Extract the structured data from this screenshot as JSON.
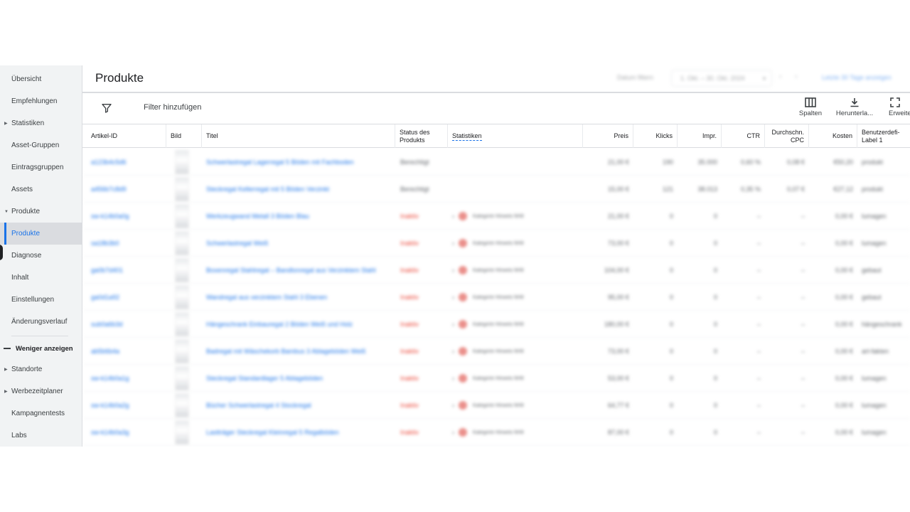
{
  "sidebar": {
    "items": [
      {
        "label": "Übersicht",
        "caret": ""
      },
      {
        "label": "Empfehlungen",
        "caret": ""
      },
      {
        "label": "Statistiken",
        "caret": "▶"
      },
      {
        "label": "Asset-Gruppen",
        "caret": ""
      },
      {
        "label": "Eintragsgruppen",
        "caret": ""
      },
      {
        "label": "Assets",
        "caret": ""
      },
      {
        "label": "Produkte",
        "caret": "▼"
      },
      {
        "label": "Produkte",
        "caret": ""
      },
      {
        "label": "Diagnose",
        "caret": ""
      },
      {
        "label": "Inhalt",
        "caret": ""
      },
      {
        "label": "Einstellungen",
        "caret": ""
      },
      {
        "label": "Änderungsverlauf",
        "caret": ""
      }
    ],
    "toggle_label": "Weniger anzeigen",
    "more_items": [
      {
        "label": "Standorte",
        "caret": "▶"
      },
      {
        "label": "Werbezeitplaner",
        "caret": "▶"
      },
      {
        "label": "Kampagnentests",
        "caret": ""
      },
      {
        "label": "Labs",
        "caret": ""
      }
    ]
  },
  "header": {
    "title": "Produkte",
    "date_label": "Datum filtern",
    "date_range": "1. Okt. – 30. Okt. 2024",
    "date_link": "Letzte 30 Tage anzeigen"
  },
  "toolbar": {
    "filter_label": "Filter hinzufügen",
    "columns_label": "Spalten",
    "download_label": "Herunterla...",
    "expand_label": "Erweitern"
  },
  "table": {
    "headers": {
      "id": "Artikel-ID",
      "image": "Bild",
      "title": "Titel",
      "status": "Status des Produkts",
      "stats": "Statistiken",
      "price": "Preis",
      "clicks": "Klicks",
      "impr": "Impr.",
      "ctr": "CTR",
      "cpc": "Durchschn. CPC",
      "cost": "Kosten",
      "label": "Benutzerdefi-Label 1"
    },
    "rows": [
      {
        "id": "a123b4c5d6",
        "title": "Schwerlastregal Lagerregal 5 Böden mit Fachboden",
        "status": "Berechtigt",
        "status_color": "#5f6368",
        "stat": "",
        "price": "21,00 €",
        "clicks": "190",
        "impr": "35.000",
        "ctr": "0,60 %",
        "cpc": "0,08 €",
        "cost": "€50,20",
        "label": "produkt"
      },
      {
        "id": "a456b7c8d9",
        "title": "Steckregal Kellerregal mit 5 Böden Verzinkt",
        "status": "Berechtigt",
        "status_color": "#5f6368",
        "stat": "",
        "price": "15,00 €",
        "clicks": "121",
        "impr": "38.013",
        "ctr": "0,35 %",
        "cpc": "0,07 €",
        "cost": "€27,12",
        "label": "produkt"
      },
      {
        "id": "sw-k14b0a0g",
        "title": "Werkzeugwand Metall 3 Böden Blau",
        "status": "Inaktiv",
        "status_color": "#ea4335",
        "stat": "Kategorie Hinweis fehlt",
        "price": "21,00 €",
        "clicks": "0",
        "impr": "0",
        "ctr": "–",
        "cpc": "–",
        "cost": "0,00 €",
        "label": "lumagen"
      },
      {
        "id": "sa18b3b0",
        "title": "Schwerlastregal Weiß",
        "status": "Inaktiv",
        "status_color": "#ea4335",
        "stat": "Kategorie Hinweis fehlt",
        "price": "73,00 €",
        "clicks": "0",
        "impr": "0",
        "ctr": "–",
        "cpc": "–",
        "cost": "0,00 €",
        "label": "lumagen"
      },
      {
        "id": "ga0b7d401",
        "title": "Boxenregal Stahlregal – Bandlonregal aus Verzinktem Stahl",
        "status": "Inaktiv",
        "status_color": "#ea4335",
        "stat": "Kategorie Hinweis fehlt",
        "price": "104,00 €",
        "clicks": "0",
        "impr": "0",
        "ctr": "–",
        "cpc": "–",
        "cost": "0,00 €",
        "label": "gebaut"
      },
      {
        "id": "ga0d1a92",
        "title": "Wandregal aus verzinktem Stahl 3 Ebenen",
        "status": "Inaktiv",
        "status_color": "#ea4335",
        "stat": "Kategorie Hinweis fehlt",
        "price": "95,00 €",
        "clicks": "0",
        "impr": "0",
        "ctr": "–",
        "cpc": "–",
        "cost": "0,00 €",
        "label": "gebaut"
      },
      {
        "id": "sub0a6b3d",
        "title": "Hängeschrank Einbauregal 2 Böden Weiß und Holz",
        "status": "Inaktiv",
        "status_color": "#ea4335",
        "stat": "Kategorie Hinweis fehlt",
        "price": "180,00 €",
        "clicks": "0",
        "impr": "0",
        "ctr": "–",
        "cpc": "–",
        "cost": "0,00 €",
        "label": "hängeschrank"
      },
      {
        "id": "ab5b6b4a",
        "title": "Badregal mit Wäschekorb Bambus 3 Ablageböden Weiß",
        "status": "Inaktiv",
        "status_color": "#ea4335",
        "stat": "Kategorie Hinweis fehlt",
        "price": "73,00 €",
        "clicks": "0",
        "impr": "0",
        "ctr": "–",
        "cpc": "–",
        "cost": "0,00 €",
        "label": "art-fakten"
      },
      {
        "id": "sw-k14b0a1g",
        "title": "Steckregal Standardlager 5 Ablageböden",
        "status": "Inaktiv",
        "status_color": "#ea4335",
        "stat": "Kategorie Hinweis fehlt",
        "price": "53,00 €",
        "clicks": "0",
        "impr": "0",
        "ctr": "–",
        "cpc": "–",
        "cost": "0,00 €",
        "label": "lumagen"
      },
      {
        "id": "sw-k14b0a2g",
        "title": "Bücher Schwerlastregal 4 Stockregal",
        "status": "Inaktiv",
        "status_color": "#ea4335",
        "stat": "Kategorie Hinweis fehlt",
        "price": "64,77 €",
        "clicks": "0",
        "impr": "0",
        "ctr": "–",
        "cpc": "–",
        "cost": "0,00 €",
        "label": "lumagen"
      },
      {
        "id": "sw-k14b0a3g",
        "title": "Lastträger Steckregal Kleinregal 5 Regalböden",
        "status": "Inaktiv",
        "status_color": "#ea4335",
        "stat": "Kategorie Hinweis fehlt",
        "price": "87,00 €",
        "clicks": "0",
        "impr": "0",
        "ctr": "–",
        "cpc": "–",
        "cost": "0,00 €",
        "label": "lumagen"
      }
    ]
  },
  "colors": {
    "accent": "#1a73e8",
    "inactive": "#ea4335",
    "sidebar_bg": "#f1f3f4"
  }
}
